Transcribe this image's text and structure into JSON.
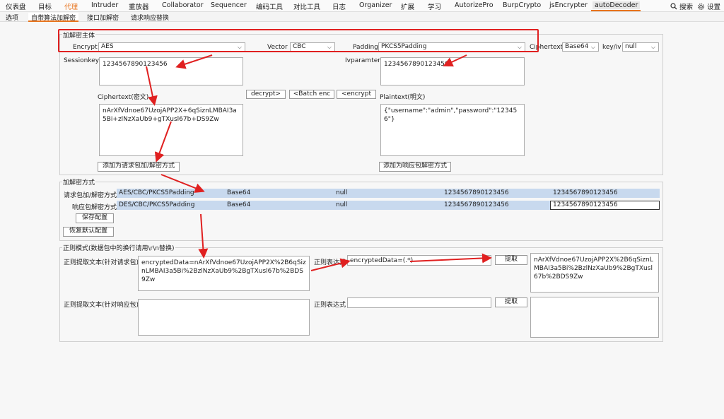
{
  "menu": {
    "items": [
      "仪表盘",
      "目标",
      "代理",
      "Intruder",
      "重放器",
      "Collaborator",
      "Sequencer",
      "编码工具",
      "对比工具",
      "日志",
      "Organizer",
      "扩展",
      "学习",
      "AutorizePro",
      "BurpCrypto",
      "jsEncrypter",
      "autoDecoder"
    ],
    "search_label": "搜索",
    "settings_label": "设置"
  },
  "subtabs": [
    "选项",
    "自带算法加解密",
    "接口加解密",
    "请求响应替换"
  ],
  "crypto": {
    "group_title": "加解密主体",
    "encrypt_label": "Encrypt",
    "encrypt_value": "AES",
    "vector_label": "Vector",
    "vector_value": "CBC",
    "padding_label": "Padding",
    "padding_value": "PKCS5Padding",
    "ciphertext_fmt_label": "Ciphertext",
    "ciphertext_fmt_value": "Base64",
    "keyiv_label": "key/iv",
    "keyiv_value": "null",
    "sessionkey_label": "Sessionkey",
    "sessionkey_value": "1234567890123456",
    "ivparam_label": "Ivparamter",
    "ivparam_value": "1234567890123456",
    "ciphertext_label": "Ciphertext(密文)",
    "ciphertext_value": "nArXfVdnoe67UzojAPP2X+6qSiznLMBAI3a5Bi+zlNzXaUb9+gTXusl67b+DS9Zw",
    "plaintext_label": "Plaintext(明文)",
    "plaintext_value": "{\"username\":\"admin\",\"password\":\"123456\"}",
    "decrypt_btn": "decrypt>",
    "batch_enc_btn": "<Batch enc",
    "encrypt_btn": "<encrypt",
    "add_request_btn": "添加为请求包加/解密方式",
    "add_response_btn": "添加为响应包解密方式"
  },
  "methods": {
    "group_title": "加解密方式",
    "rows": [
      {
        "label": "请求包加/解密方式",
        "algo": "AES/CBC/PKCS5Padding",
        "format": "Base64",
        "keyiv": "null",
        "key": "1234567890123456",
        "iv": "1234567890123456"
      },
      {
        "label": "响应包解密方式",
        "algo": "DES/CBC/PKCS5Padding",
        "format": "Base64",
        "keyiv": "null",
        "key": "1234567890123456",
        "iv": "1234567890123456"
      }
    ],
    "save_btn": "保存配置",
    "restore_btn": "恢复默认配置"
  },
  "regex": {
    "group_title": "正则模式(数据包中的换行请用\\r\\n替换)",
    "req_text_label": "正则提取文本(针对请求包)",
    "req_text_value": "encryptedData=nArXfVdnoe67UzojAPP2X%2B6qSiznLMBAI3a5Bi%2BzlNzXaUb9%2BgTXusl67b%2BDS9Zw",
    "req_expr_label": "正则表达式",
    "req_expr_value": "encryptedData=(.*)",
    "req_extract_btn": "提取",
    "req_result_value": "nArXfVdnoe67UzojAPP2X%2B6qSiznLMBAI3a5Bi%2BzlNzXaUb9%2BgTXusl67b%2BDS9Zw",
    "resp_text_label": "正则提取文本(针对响应包)",
    "resp_text_value": "",
    "resp_expr_label": "正则表达式",
    "resp_expr_value": "",
    "resp_extract_btn": "提取",
    "resp_result_value": ""
  },
  "colors": {
    "accent": "#e8731c",
    "annotation_red": "#e02020",
    "row_highlight": "#c8d9ee"
  }
}
